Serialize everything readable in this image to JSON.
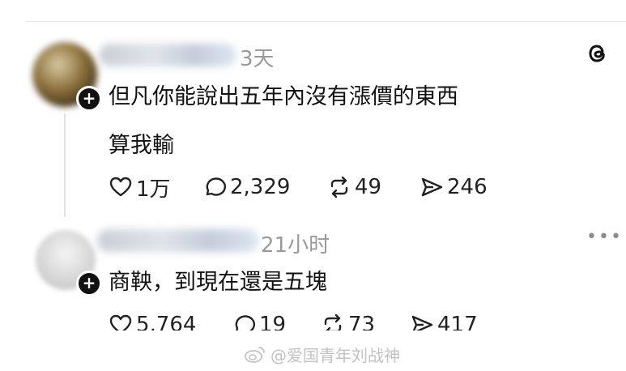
{
  "posts": [
    {
      "time": "3天",
      "text_line1": "但凡你能說出五年內沒有漲價的東西",
      "text_line2": "算我輸",
      "likes": "1万",
      "comments": "2,329",
      "reposts": "49",
      "shares": "246"
    },
    {
      "time": "21小时",
      "text": "商鞅，到現在還是五塊",
      "likes": "5,764",
      "comments": "19",
      "reposts": "73",
      "shares": "417"
    }
  ],
  "more_label": "•••",
  "follow_badge": "+",
  "watermark": "@爱国青年刘战神",
  "icons": [
    "threads-icon",
    "heart-icon",
    "comment-icon",
    "repost-icon",
    "share-icon",
    "more-icon",
    "weibo-icon"
  ]
}
